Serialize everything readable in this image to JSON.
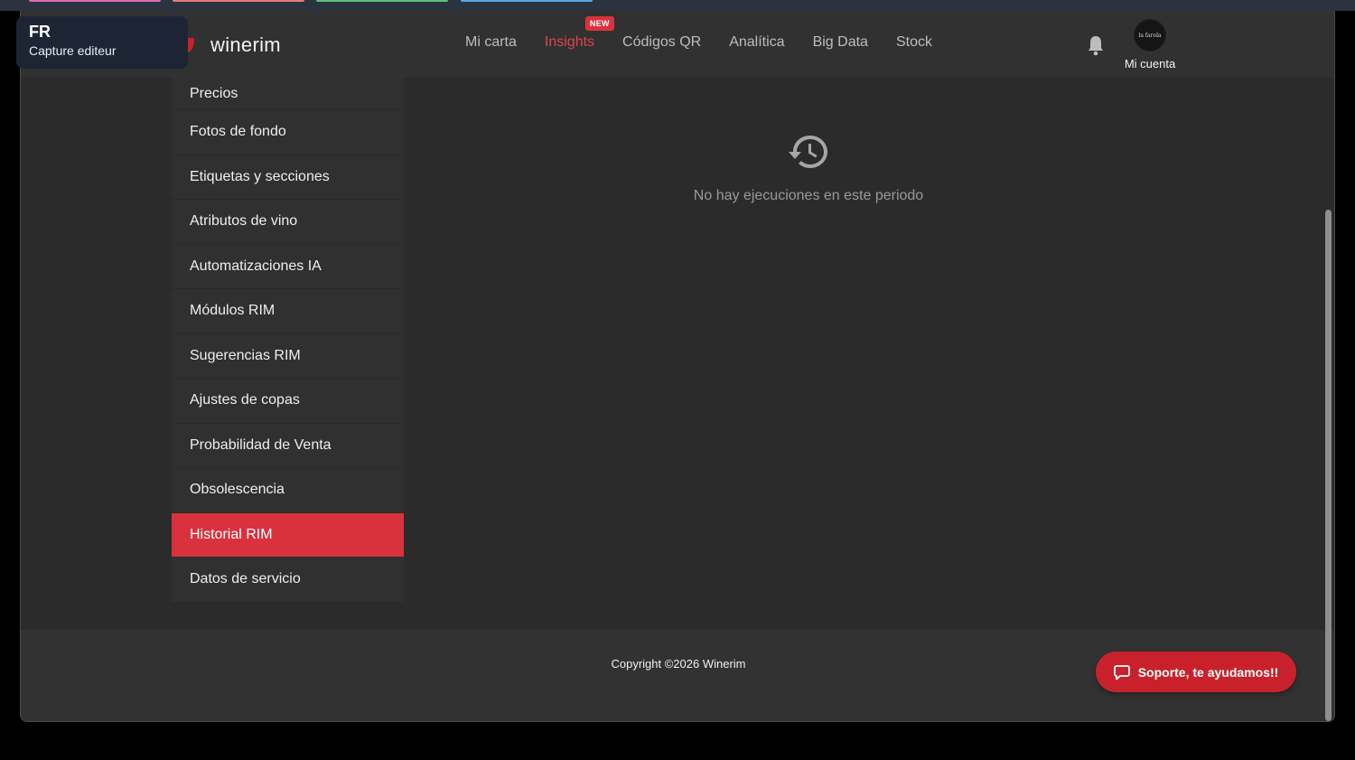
{
  "overlay": {
    "code": "FR",
    "subtitle": "Capture editeur"
  },
  "brand": {
    "name": "winerim"
  },
  "nav": {
    "links": [
      {
        "label": "Mi carta"
      },
      {
        "label": "Insights",
        "badge": "NEW"
      },
      {
        "label": "Códigos QR"
      },
      {
        "label": "Analítica"
      },
      {
        "label": "Big Data"
      },
      {
        "label": "Stock"
      }
    ],
    "account_label": "Mi cuenta",
    "avatar_text": "la farola"
  },
  "sidebar": {
    "items": [
      {
        "label": "Precios"
      },
      {
        "label": "Fotos de fondo"
      },
      {
        "label": "Etiquetas y secciones"
      },
      {
        "label": "Atributos de vino"
      },
      {
        "label": "Automatizaciones IA"
      },
      {
        "label": "Módulos RIM"
      },
      {
        "label": "Sugerencias RIM"
      },
      {
        "label": "Ajustes de copas"
      },
      {
        "label": "Probabilidad de Venta"
      },
      {
        "label": "Obsolescencia"
      },
      {
        "label": "Historial RIM"
      },
      {
        "label": "Datos de servicio"
      }
    ],
    "active_index": 10
  },
  "main": {
    "empty_message": "No hay ejecuciones en este periodo"
  },
  "footer": {
    "copyright": "Copyright ©2026 Winerim"
  },
  "support": {
    "label": "Soporte, te ayudamos!!"
  },
  "colors": {
    "accent": "#d9323e",
    "support": "#c9212b",
    "background": "#2b2b2b",
    "navbar": "#313131"
  },
  "icons": {
    "bell": "bell-icon",
    "history": "history-icon",
    "chat": "chat-bubble-icon",
    "logo": "winerim-logo"
  }
}
